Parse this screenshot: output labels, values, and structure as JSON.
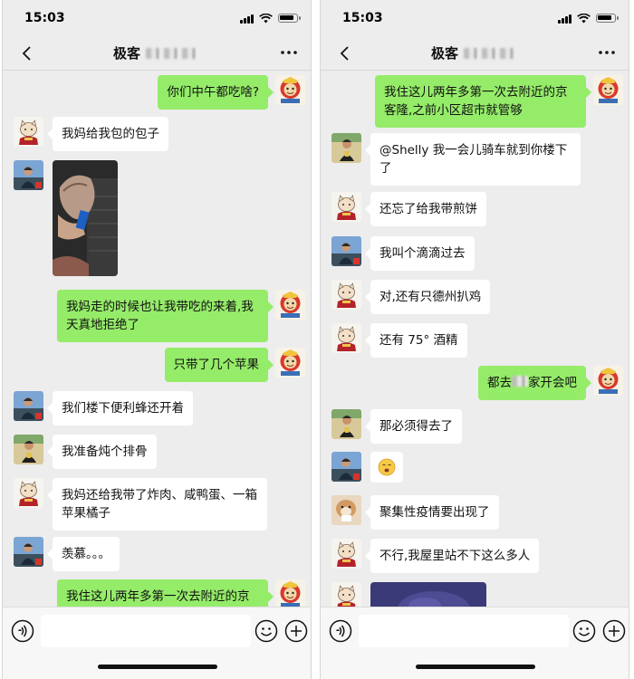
{
  "colors": {
    "chat_bg": "#ededed",
    "self_bubble": "#95ec69",
    "other_bubble": "#ffffff"
  },
  "status_bar": {
    "time": "15:03"
  },
  "chat_header": {
    "title_prefix": "极客"
  },
  "icons": {
    "back": "chevron-left-icon",
    "more": "more-dots-icon",
    "voice": "voice-icon",
    "emoji": "emoji-icon",
    "plus": "plus-icon"
  },
  "left_screen": {
    "messages": [
      {
        "side": "right",
        "avatar": "cat-avatar",
        "text": "你们中午都吃啥?"
      },
      {
        "side": "left",
        "avatar": "cat-avatar",
        "text": "我妈给我包的包子"
      },
      {
        "side": "left",
        "avatar": "person-avatar",
        "type": "image",
        "text": ""
      },
      {
        "side": "right",
        "avatar": "cat-avatar",
        "text": "我妈走的时候也让我带吃的来着,我天真地拒绝了"
      },
      {
        "side": "right",
        "avatar": "cat-avatar",
        "text": "只带了几个苹果"
      },
      {
        "side": "left",
        "avatar": "person-avatar",
        "text": "我们楼下便利蜂还开着"
      },
      {
        "side": "left",
        "avatar": "person-avatar-2",
        "text": "我准备炖个排骨"
      },
      {
        "side": "left",
        "avatar": "cat-avatar",
        "text": "我妈还给我带了炸肉、咸鸭蛋、一箱苹果橘子"
      },
      {
        "side": "left",
        "avatar": "person-avatar",
        "text": "羡慕。。。"
      },
      {
        "side": "right",
        "avatar": "cat-avatar",
        "text": "我住这儿两年多第一次去附近的京客隆,之前小区超市就管够"
      }
    ]
  },
  "right_screen": {
    "messages": [
      {
        "side": "right",
        "avatar": "cat-avatar",
        "text": "我住这儿两年多第一次去附近的京客隆,之前小区超市就管够"
      },
      {
        "side": "left",
        "avatar": "person-avatar-2",
        "text": "@Shelly 我一会儿骑车就到你楼下了"
      },
      {
        "side": "left",
        "avatar": "cat-avatar",
        "text": "还忘了给我带煎饼"
      },
      {
        "side": "left",
        "avatar": "person-avatar",
        "text": "我叫个滴滴过去"
      },
      {
        "side": "left",
        "avatar": "cat-avatar",
        "text": "对,还有只德州扒鸡"
      },
      {
        "side": "left",
        "avatar": "cat-avatar",
        "text": "还有 75° 酒精"
      },
      {
        "side": "right",
        "avatar": "cat-avatar",
        "text_before": "都去",
        "text_after": "家开会吧"
      },
      {
        "side": "left",
        "avatar": "person-avatar-2",
        "text": "那必须得去了"
      },
      {
        "side": "left",
        "avatar": "person-avatar",
        "type": "emoji",
        "text": ""
      },
      {
        "side": "left",
        "avatar": "cat-photo-avatar",
        "text": "聚集性疫情要出现了"
      },
      {
        "side": "left",
        "avatar": "cat-avatar",
        "text": "不行,我屋里站不下这么多人"
      },
      {
        "side": "left",
        "avatar": "cat-avatar",
        "type": "image",
        "text": ""
      }
    ]
  }
}
